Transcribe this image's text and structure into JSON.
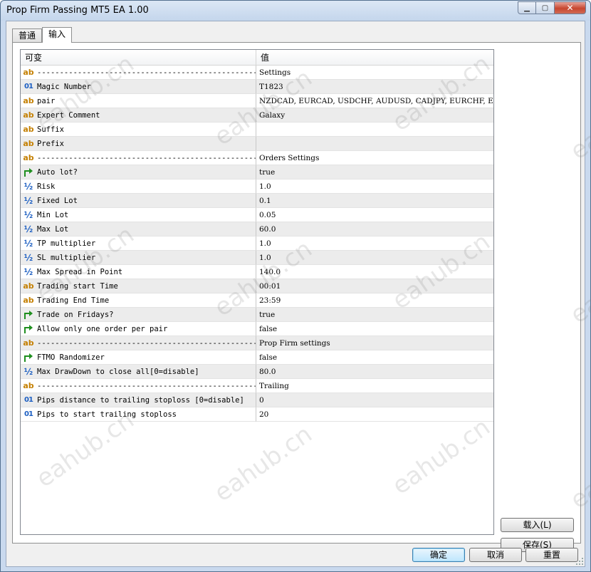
{
  "window": {
    "title": "Prop Firm Passing MT5 EA 1.00"
  },
  "tabs": [
    {
      "label": "普通",
      "active": false
    },
    {
      "label": "输入",
      "active": true
    }
  ],
  "grid": {
    "col_variable": "可变",
    "col_value": "值",
    "rows": [
      {
        "type": "ab",
        "name": "--------------------------------------------------...",
        "value": "Settings"
      },
      {
        "type": "int",
        "name": "Magic Number",
        "value": "T1823"
      },
      {
        "type": "ab",
        "name": "pair",
        "value": "NZDCAD, EURCAD, USDCHF, AUDUSD, CADJPY, EURCHF, EURJPY, GB..."
      },
      {
        "type": "ab",
        "name": "Expert Comment",
        "value": "Galaxy"
      },
      {
        "type": "ab",
        "name": "Suffix",
        "value": ""
      },
      {
        "type": "ab",
        "name": "Prefix",
        "value": ""
      },
      {
        "type": "ab",
        "name": "--------------------------------------------------...",
        "value": "Orders Settings"
      },
      {
        "type": "bool",
        "name": "Auto lot?",
        "value": "true"
      },
      {
        "type": "dbl",
        "name": "Risk",
        "value": "1.0"
      },
      {
        "type": "dbl",
        "name": "Fixed Lot",
        "value": "0.1"
      },
      {
        "type": "dbl",
        "name": "Min Lot",
        "value": "0.05"
      },
      {
        "type": "dbl",
        "name": "Max Lot",
        "value": "60.0"
      },
      {
        "type": "dbl",
        "name": "TP multiplier",
        "value": "1.0"
      },
      {
        "type": "dbl",
        "name": "SL multiplier",
        "value": "1.0"
      },
      {
        "type": "dbl",
        "name": "Max Spread in Point",
        "value": "140.0"
      },
      {
        "type": "ab",
        "name": "Trading start Time",
        "value": "00:01"
      },
      {
        "type": "ab",
        "name": "Trading End Time",
        "value": "23:59"
      },
      {
        "type": "bool",
        "name": "Trade on Fridays?",
        "value": "true"
      },
      {
        "type": "bool",
        "name": "Allow only one order per pair",
        "value": "false"
      },
      {
        "type": "ab",
        "name": "--------------------------------------------------...",
        "value": "Prop Firm settings"
      },
      {
        "type": "bool",
        "name": "FTMO Randomizer",
        "value": "false"
      },
      {
        "type": "dbl",
        "name": "Max DrawDown to close all[0=disable]",
        "value": "80.0"
      },
      {
        "type": "ab",
        "name": "--------------------------------------------------...",
        "value": "Trailing"
      },
      {
        "type": "int",
        "name": "Pips distance to trailing stoploss [0=disable]",
        "value": "0"
      },
      {
        "type": "int",
        "name": "Pips to start trailing stoploss",
        "value": "20"
      }
    ]
  },
  "icons": {
    "ab": "ab",
    "int": "01",
    "dbl": "½"
  },
  "buttons": {
    "load": "载入(L)",
    "save": "保存(S)",
    "ok": "确定",
    "cancel": "取消",
    "reset": "重置"
  },
  "watermark": "eahub.cn"
}
